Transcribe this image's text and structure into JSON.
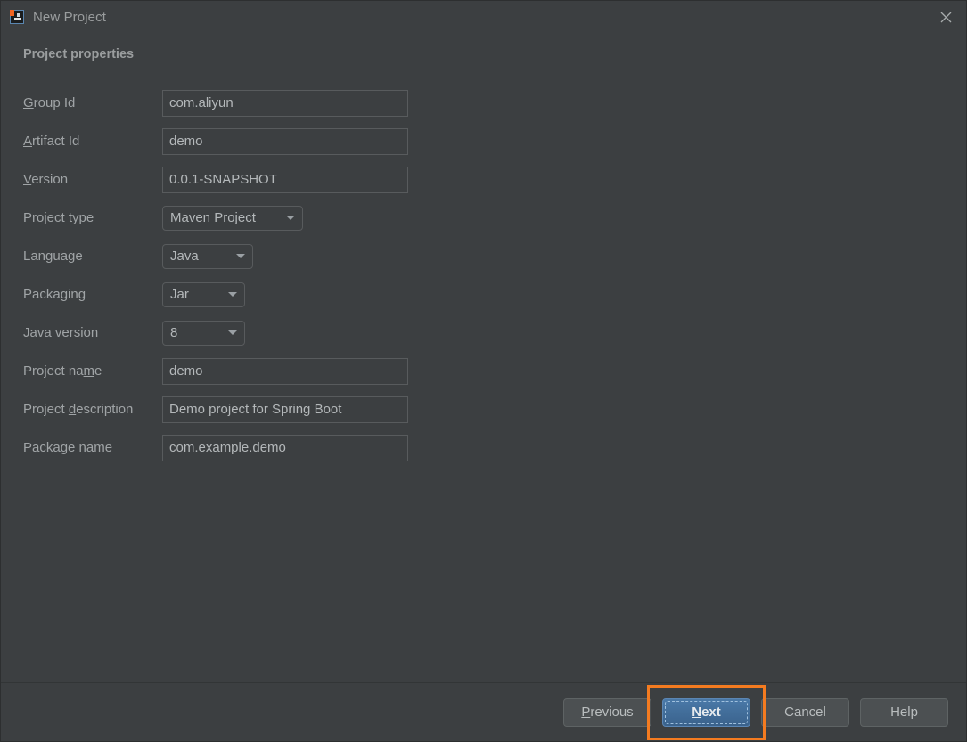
{
  "window": {
    "title": "New Project",
    "icon": "intellij-idea-icon",
    "close_label": "✕",
    "accent_highlight_color": "#f47b20",
    "background_color": "#3c3f41",
    "focus_button_color": "#4a79a8"
  },
  "section": {
    "title": "Project properties"
  },
  "form": {
    "rows": [
      {
        "type": "text",
        "name": "group-id",
        "label_pre": "",
        "label_mn": "G",
        "label_post": "roup Id",
        "value": "com.aliyun"
      },
      {
        "type": "text",
        "name": "artifact-id",
        "label_pre": "",
        "label_mn": "A",
        "label_post": "rtifact Id",
        "value": "demo"
      },
      {
        "type": "text",
        "name": "version",
        "label_pre": "",
        "label_mn": "V",
        "label_post": "ersion",
        "value": "0.0.1-SNAPSHOT"
      },
      {
        "type": "combo",
        "name": "project-type",
        "label_pre": "Project type",
        "label_mn": "",
        "label_post": "",
        "value": "Maven Project"
      },
      {
        "type": "combo",
        "name": "language",
        "label_pre": "Language",
        "label_mn": "",
        "label_post": "",
        "value": "Java"
      },
      {
        "type": "combo",
        "name": "packaging",
        "label_pre": "Packaging",
        "label_mn": "",
        "label_post": "",
        "value": "Jar"
      },
      {
        "type": "combo",
        "name": "java-version",
        "label_pre": "Java version",
        "label_mn": "",
        "label_post": "",
        "value": "8"
      },
      {
        "type": "text",
        "name": "project-name",
        "label_pre": "Project na",
        "label_mn": "m",
        "label_post": "e",
        "value": "demo"
      },
      {
        "type": "text",
        "name": "project-description",
        "label_pre": "Project ",
        "label_mn": "d",
        "label_post": "escription",
        "value": "Demo project for Spring Boot"
      },
      {
        "type": "text",
        "name": "package-name",
        "label_pre": "Pac",
        "label_mn": "k",
        "label_post": "age name",
        "value": "com.example.demo"
      }
    ]
  },
  "footer": {
    "previous": {
      "pre": "",
      "mn": "P",
      "post": "revious"
    },
    "next": {
      "pre": "",
      "mn": "N",
      "post": "ext"
    },
    "cancel": {
      "pre": "Cancel",
      "mn": "",
      "post": ""
    },
    "help": {
      "pre": "Help",
      "mn": "",
      "post": ""
    }
  }
}
